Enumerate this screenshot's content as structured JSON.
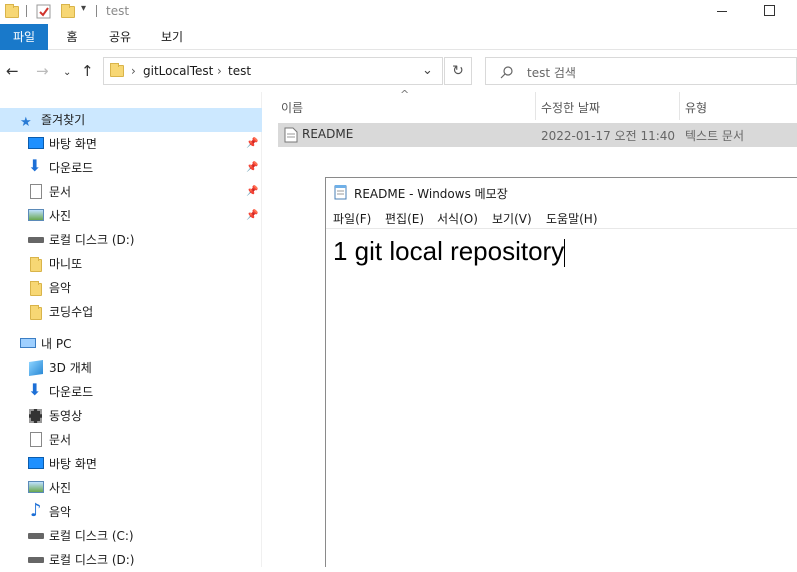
{
  "titlebar": {
    "title": "test"
  },
  "ribbon": {
    "tabs": [
      "파일",
      "홈",
      "공유",
      "보기"
    ]
  },
  "address": {
    "crumbs": [
      "gitLocalTest",
      "test"
    ],
    "separator": "›"
  },
  "search": {
    "placeholder": "test 검색"
  },
  "navpane": {
    "quick_access": "즐겨찾기",
    "quick_items": [
      "바탕 화면",
      "다운로드",
      "문서",
      "사진",
      "로컬 디스크 (D:)",
      "마니또",
      "음악",
      "코딩수업"
    ],
    "this_pc": "내 PC",
    "pc_items": [
      "3D 개체",
      "다운로드",
      "동영상",
      "문서",
      "바탕 화면",
      "사진",
      "음악",
      "로컬 디스크 (C:)",
      "로컬 디스크 (D:)"
    ]
  },
  "filelist": {
    "columns": [
      "이름",
      "수정한 날짜",
      "유형"
    ],
    "rows": [
      {
        "name": "README",
        "modified": "2022-01-17 오전 11:40",
        "type": "텍스트 문서"
      }
    ]
  },
  "notepad": {
    "title": "README - Windows 메모장",
    "menu": [
      "파일(F)",
      "편집(E)",
      "서식(O)",
      "보기(V)",
      "도움말(H)"
    ],
    "content": "1 git local repository"
  },
  "colors": {
    "accent": "#1979ca",
    "selection": "#cce8ff",
    "row_highlight": "#d9d9d9"
  }
}
